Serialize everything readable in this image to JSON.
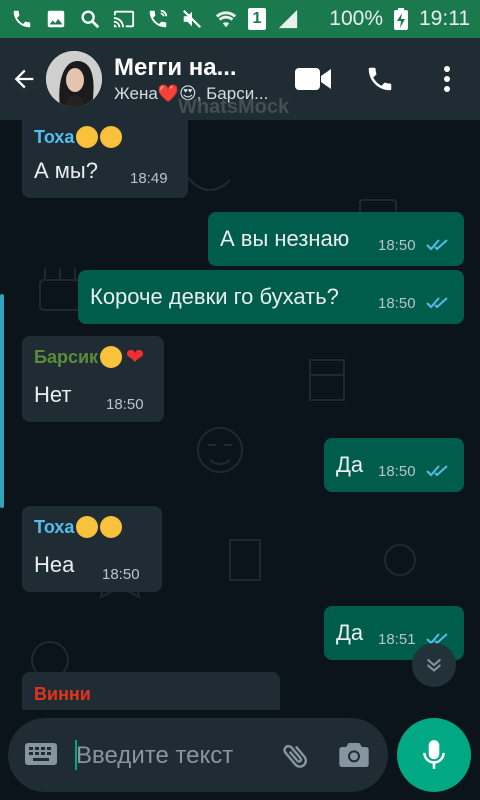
{
  "status_bar": {
    "battery_percent": "100%",
    "time": "19:11",
    "sim_number": "1"
  },
  "header": {
    "title": "Мегги на...",
    "subtitle": "Жена❤️😍, Барси...",
    "watermark": "WhatsMock"
  },
  "messages": [
    {
      "dir": "in",
      "sender": "Тоха",
      "sender_color": "#53bdeb",
      "text": "А мы?",
      "time": "18:49"
    },
    {
      "dir": "out",
      "text": "А вы незнаю",
      "time": "18:50"
    },
    {
      "dir": "out",
      "text": "Короче девки го бухать?",
      "time": "18:50"
    },
    {
      "dir": "in",
      "sender": "Барсик",
      "sender_color": "#5e8c3a",
      "text": "Нет",
      "time": "18:50"
    },
    {
      "dir": "out",
      "text": "Да",
      "time": "18:50"
    },
    {
      "dir": "in",
      "sender": "Тоха",
      "sender_color": "#53bdeb",
      "text": "Неа",
      "time": "18:50"
    },
    {
      "dir": "out",
      "text": "Да",
      "time": "18:51"
    },
    {
      "dir": "in",
      "sender": "Винни",
      "sender_color": "#e5331b"
    }
  ],
  "input": {
    "placeholder": "Введите текст"
  },
  "colors": {
    "status_bar": "#1a7a4e",
    "header": "#1f2c33",
    "incoming": "#1f2c33",
    "outgoing": "#005c4b",
    "accent": "#00a884",
    "read_ticks": "#53bdeb"
  }
}
